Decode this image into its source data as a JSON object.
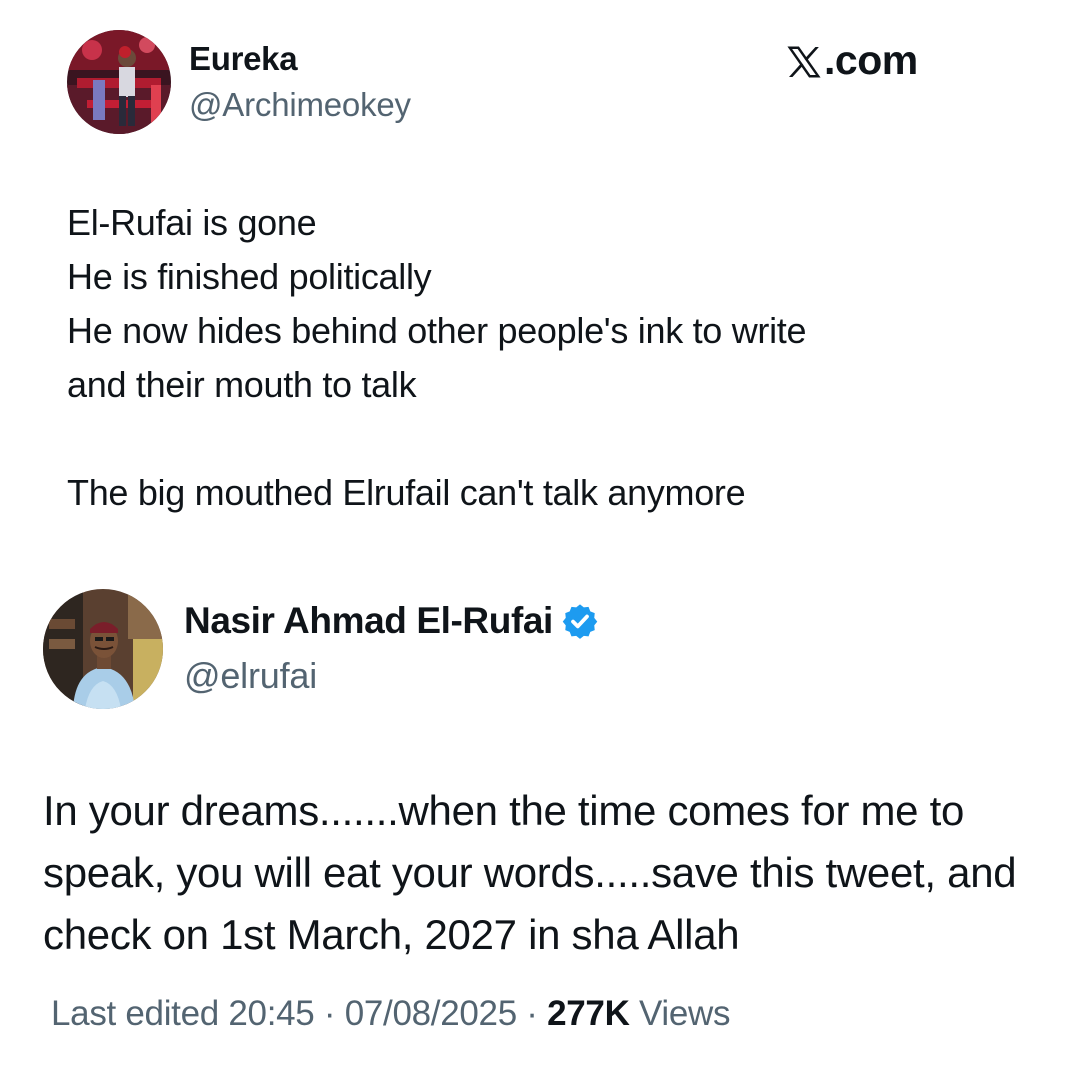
{
  "brand": {
    "label": ".com"
  },
  "quoted_tweet": {
    "display_name": "Eureka",
    "handle": "@Archimeokey",
    "text": "El-Rufai is gone\nHe is finished politically\nHe now hides behind other people's ink to write\nand their mouth to talk\n\nThe big mouthed Elrufail can't talk anymore"
  },
  "main_tweet": {
    "display_name": "Nasir Ahmad El-Rufai",
    "handle": "@elrufai",
    "verified": true,
    "text": "In your dreams.......when the time comes for me to speak, you will eat your words.....save this tweet, and check on 1st March, 2027 in sha Allah",
    "edited_label": "Last edited",
    "time": "20:45",
    "separator": " · ",
    "date": "07/08/2025",
    "separator2": " · ",
    "views_count": "277K",
    "views_label": " Views"
  },
  "colors": {
    "text": "#0f1419",
    "secondary": "#536471",
    "verified_blue": "#1d9bf0"
  }
}
